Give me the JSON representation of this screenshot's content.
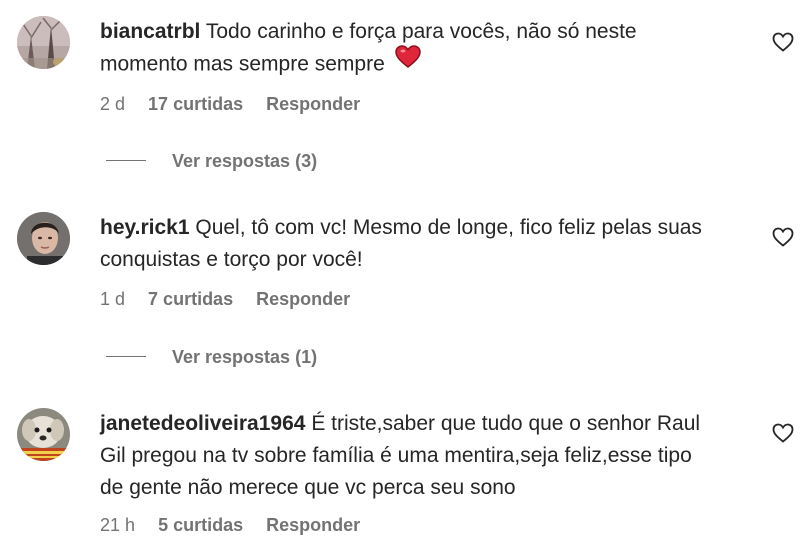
{
  "comments": [
    {
      "username": "biancatrbl",
      "text_line1": "Todo carinho e força para vocês, não só neste",
      "text_line2": "momento mas sempre sempre",
      "time": "2 d",
      "likes": "17 curtidas",
      "reply": "Responder",
      "replies": "Ver respostas (3)"
    },
    {
      "username": "hey.rick1",
      "text_line1": "Quel, tô com vc! Mesmo de longe, fico feliz pelas suas",
      "text_line2": "conquistas e torço por você!",
      "time": "1 d",
      "likes": "7 curtidas",
      "reply": "Responder",
      "replies": "Ver respostas (1)"
    },
    {
      "username": "janetedeoliveira1964",
      "text_line1": "É triste,saber que tudo que o senhor Raul",
      "text_line2": "Gil pregou na tv sobre família é uma mentira,seja feliz,esse tipo",
      "text_line3": "de gente não merece que vc perca seu sono",
      "time": "21 h",
      "likes": "5 curtidas",
      "reply": "Responder"
    }
  ],
  "icons": {
    "like": "heart-outline-icon",
    "emoji": "red-heart-emoji-icon"
  },
  "colors": {
    "text": "#262626",
    "secondary": "#737373",
    "emoji_heart": "#e0263a"
  }
}
